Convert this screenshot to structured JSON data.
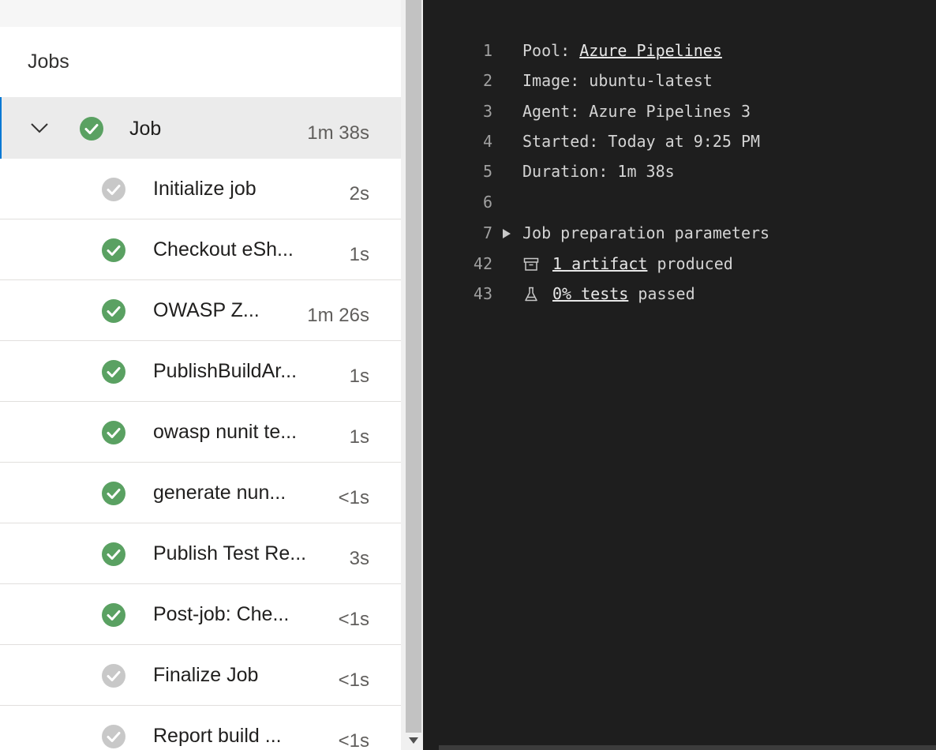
{
  "jobs_panel": {
    "header": "Jobs",
    "job": {
      "name": "Job",
      "duration": "1m 38s",
      "status": "success"
    },
    "steps": [
      {
        "name": "Initialize job",
        "duration": "2s",
        "status": "skipped"
      },
      {
        "name": "Checkout eSh...",
        "duration": "1s",
        "status": "success"
      },
      {
        "name": "OWASP Z...",
        "duration": "1m 26s",
        "status": "success"
      },
      {
        "name": "PublishBuildAr...",
        "duration": "1s",
        "status": "success"
      },
      {
        "name": "owasp nunit te...",
        "duration": "1s",
        "status": "success"
      },
      {
        "name": "generate nun...",
        "duration": "<1s",
        "status": "success"
      },
      {
        "name": "Publish Test Re...",
        "duration": "3s",
        "status": "success"
      },
      {
        "name": "Post-job: Che...",
        "duration": "<1s",
        "status": "success"
      },
      {
        "name": "Finalize Job",
        "duration": "<1s",
        "status": "skipped"
      },
      {
        "name": "Report build ...",
        "duration": "<1s",
        "status": "skipped"
      }
    ]
  },
  "log": {
    "line1": {
      "num": "1",
      "label": "Pool: ",
      "link": "Azure Pipelines"
    },
    "line2": {
      "num": "2",
      "text": "Image: ubuntu-latest"
    },
    "line3": {
      "num": "3",
      "text": "Agent: Azure Pipelines 3"
    },
    "line4": {
      "num": "4",
      "text": "Started: Today at 9:25 PM"
    },
    "line5": {
      "num": "5",
      "text": "Duration: 1m 38s"
    },
    "line6": {
      "num": "6",
      "text": ""
    },
    "line7": {
      "num": "7",
      "text": "Job preparation parameters"
    },
    "line42": {
      "num": "42",
      "link": "1 artifact",
      "suffix": " produced"
    },
    "line43": {
      "num": "43",
      "link": "0% tests",
      "suffix": " passed"
    }
  },
  "colors": {
    "success": "#5aa162",
    "skipped": "#c8c8c8",
    "log_background": "#1e1e1e",
    "selected_row": "#ebebeb",
    "selection_accent": "#0078d4"
  },
  "icons": {
    "job_toggle": "chevron-down-icon",
    "success": "check-circle-icon",
    "skipped": "check-circle-gray-icon",
    "expand": "caret-right-icon",
    "artifact": "archive-icon",
    "tests": "flask-icon"
  }
}
